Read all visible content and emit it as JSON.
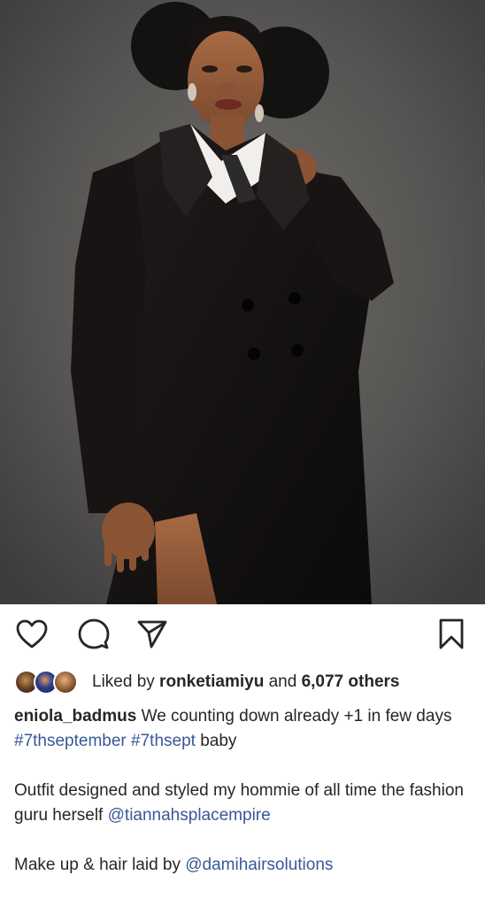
{
  "post": {
    "image_alt_icon": "portrait-photo",
    "actions": {
      "like_icon": "heart-icon",
      "comment_icon": "comment-icon",
      "share_icon": "send-icon",
      "save_icon": "bookmark-icon"
    },
    "likes": {
      "prefix": "Liked by ",
      "user": "ronketiamiyu",
      "middle": " and ",
      "count": "6,077 others"
    },
    "caption": {
      "username": "eniola_badmus",
      "text1": " We counting down already +1 in few days",
      "hashtag1": "#7thseptember",
      "space": " ",
      "hashtag2": "#7thsept",
      "text2": " baby",
      "line3": "Outfit designed and styled my hommie of all time the fashion guru herself ",
      "mention1": "@tiannahsplacempire",
      "line4": "Make up & hair laid by ",
      "mention2": "@damihairsolutions"
    }
  },
  "colors": {
    "link": "#385898",
    "text": "#262626",
    "background": "#ffffff"
  }
}
